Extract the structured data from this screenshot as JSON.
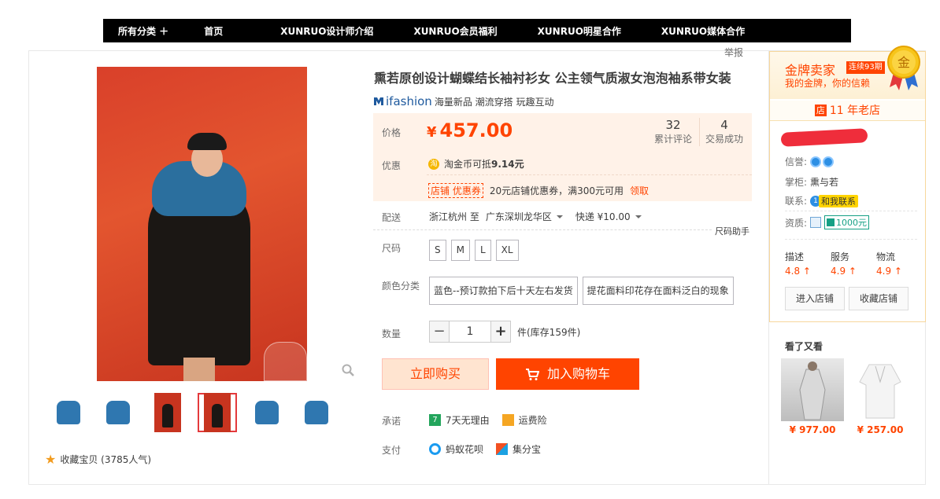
{
  "nav": {
    "items": [
      "所有分类 ＋",
      "首页",
      "XUNRUO设计师介绍",
      "XUNRUO会员福利",
      "XUNRUO明星合作",
      "XUNRUO媒体合作"
    ]
  },
  "report": "举报",
  "product": {
    "title": "熏若原创设计蝴蝶结长袖衬衫女 公主领气质淑女泡泡袖系带女装",
    "brand": "ifashion",
    "brand_slogan": "海量新品 潮流穿搭 玩趣互动",
    "price_label": "价格",
    "currency": "¥",
    "price": "457.00",
    "reviews_count": "32",
    "reviews_label": "累计评论",
    "sales_count": "4",
    "sales_label": "交易成功",
    "promo_label": "优惠",
    "coin_icon_text": "淘",
    "coin_text": "淘金币可抵",
    "coin_amount": "9.14元",
    "coupon_tag": "店铺 优惠券",
    "coupon_text": "20元店铺优惠券，满300元可用",
    "coupon_link": "领取",
    "ship_label": "配送",
    "ship_from": "浙江杭州 至",
    "ship_to": "广东深圳龙华区",
    "ship_method": "快递 ¥10.00",
    "size_help": "尺码助手",
    "size_label": "尺码",
    "sizes": [
      "S",
      "M",
      "L",
      "XL"
    ],
    "color_label": "颜色分类",
    "colors": [
      "蓝色--预订款拍下后十天左右发货",
      "提花面料印花存在面料泛白的现象"
    ],
    "qty_label": "数量",
    "qty_minus": "−",
    "qty_value": "1",
    "qty_plus": "+",
    "stock": "件(库存159件)",
    "buy_now": "立即购买",
    "add_cart": "加入购物车",
    "promise_label": "承诺",
    "promise_icon1": "7",
    "promise1": "7天无理由",
    "promise2": "运费险",
    "pay_label": "支付",
    "pay1": "蚂蚁花呗",
    "pay2": "集分宝",
    "favorite": "收藏宝贝 (3785人气)"
  },
  "shop": {
    "gold_title": "金牌卖家",
    "years_badge": "连续93期",
    "gold_sub": "我的金牌，你的信赖",
    "medal_text": "金",
    "age_icon": "店",
    "age_text": "11 年老店",
    "credit_label": "信誉:",
    "keeper_label": "掌柜:",
    "keeper_name": "熏与若",
    "contact_label": "联系:",
    "contact_badge": "和我联系",
    "qual_label": "资质:",
    "deposit": "1000元",
    "scores": [
      {
        "label": "描述",
        "value": "4.8 ↑"
      },
      {
        "label": "服务",
        "value": "4.9 ↑"
      },
      {
        "label": "物流",
        "value": "4.9 ↑"
      }
    ],
    "enter_shop": "进入店铺",
    "fav_shop": "收藏店铺"
  },
  "see_also": {
    "title": "看了又看",
    "items": [
      {
        "price": "¥ 977.00"
      },
      {
        "price": "¥ 257.00"
      }
    ]
  }
}
